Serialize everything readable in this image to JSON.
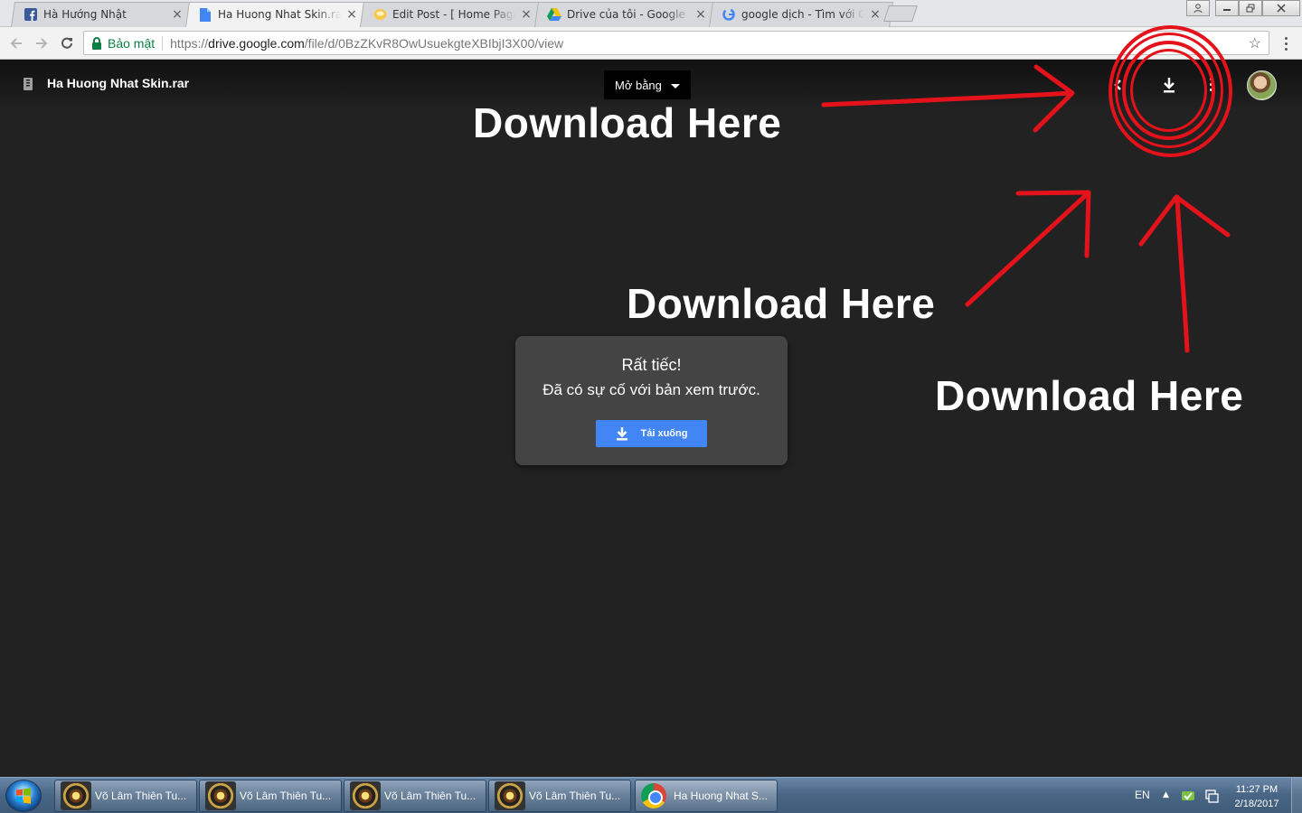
{
  "browser": {
    "tabs": [
      {
        "title": "Hà Hướng Nhật",
        "icon": "facebook-icon",
        "active": false
      },
      {
        "title": "Ha Huong Nhat Skin.rar - Google Drive",
        "icon": "drive-doc-icon",
        "active": true
      },
      {
        "title": "Edit Post - [ Home Page ] Blogger",
        "icon": "blogger-icon",
        "active": false
      },
      {
        "title": "Drive của tôi - Google Drive",
        "icon": "google-drive-icon",
        "active": false
      },
      {
        "title": "google dịch - Tìm với Google",
        "icon": "google-icon",
        "active": false
      }
    ],
    "tab_close_glyph": "×",
    "address": {
      "secure_label": "Bảo mật",
      "scheme": "https://",
      "host": "drive.google.com",
      "path": "/file/d/0BzZKvR8OwUsuekgteXBIbjI3X00/view"
    }
  },
  "viewer": {
    "file_name": "Ha Huong Nhat Skin.rar",
    "open_with_label": "Mở bằng",
    "download_icon": "download-icon"
  },
  "error_card": {
    "title": "Rất tiếc!",
    "message": "Đã có sự cố với bản xem trước.",
    "download_label": "Tải xuống"
  },
  "annotations": {
    "text_1": "Download Here",
    "text_2": "Download Here",
    "text_3": "Download Here",
    "color": "#e4121a"
  },
  "taskbar": {
    "items": [
      {
        "label": "Võ Lâm Thiên Tu...",
        "icon": "game-icon"
      },
      {
        "label": "Võ Lâm Thiên Tu...",
        "icon": "game-icon"
      },
      {
        "label": "Võ Lâm Thiên Tu...",
        "icon": "game-icon"
      },
      {
        "label": "Võ Lâm Thiên Tu...",
        "icon": "game-icon"
      },
      {
        "label": "Ha Huong Nhat S...",
        "icon": "chrome-icon"
      }
    ],
    "language": "EN",
    "time": "11:27 PM",
    "date": "2/18/2017"
  },
  "colors": {
    "viewer_bg": "#222222",
    "download_button": "#4285f4",
    "secure_green": "#0b8043"
  }
}
